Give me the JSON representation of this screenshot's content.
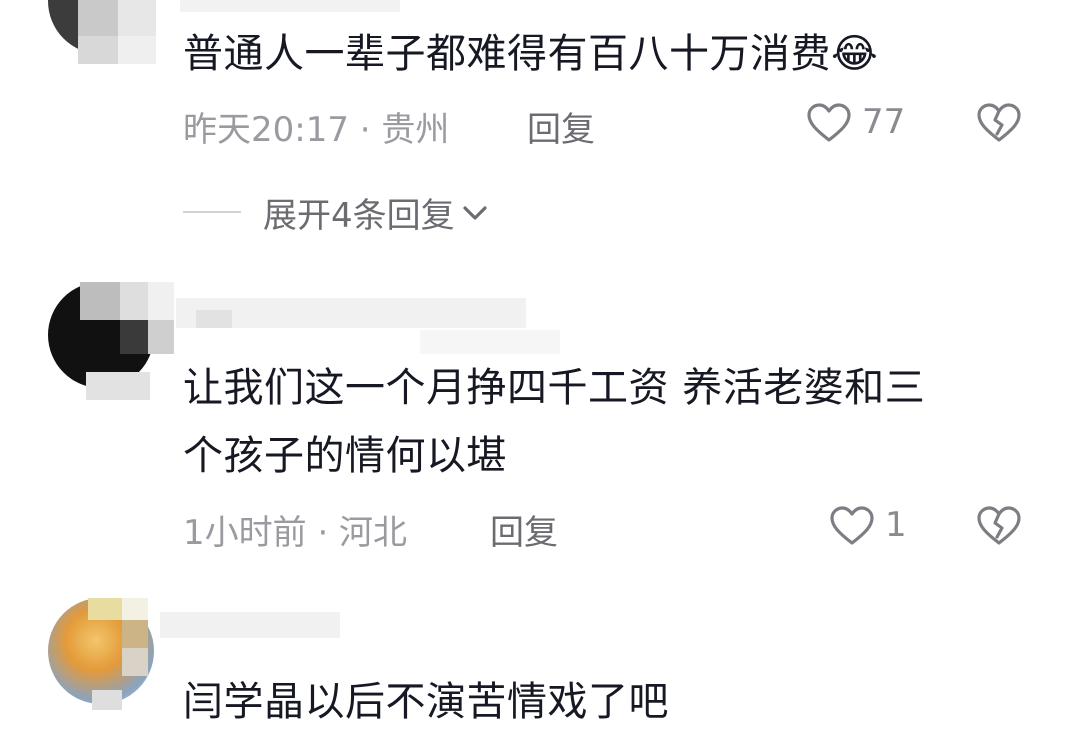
{
  "comments": [
    {
      "text": "普通人一辈子都难得有百八十万消费",
      "emoji": "😂",
      "time_location": "昨天20:17 · 贵州",
      "reply_label": "回复",
      "like_count": "77",
      "expand_label": "展开4条回复"
    },
    {
      "text_line1": "让我们这一个月挣四千工资 养活老婆和三",
      "text_line2": "个孩子的情何以堪",
      "time_location": "1小时前 · 河北",
      "reply_label": "回复",
      "like_count": "1"
    },
    {
      "text": "闫学晶以后不演苦情戏了吧"
    }
  ],
  "icons": {
    "like": "heart-outline-icon",
    "dislike": "broken-heart-icon",
    "expand": "chevron-down-icon"
  },
  "colors": {
    "text": "#161823",
    "meta": "#9a9ba0",
    "secondary": "#6b6c71"
  }
}
